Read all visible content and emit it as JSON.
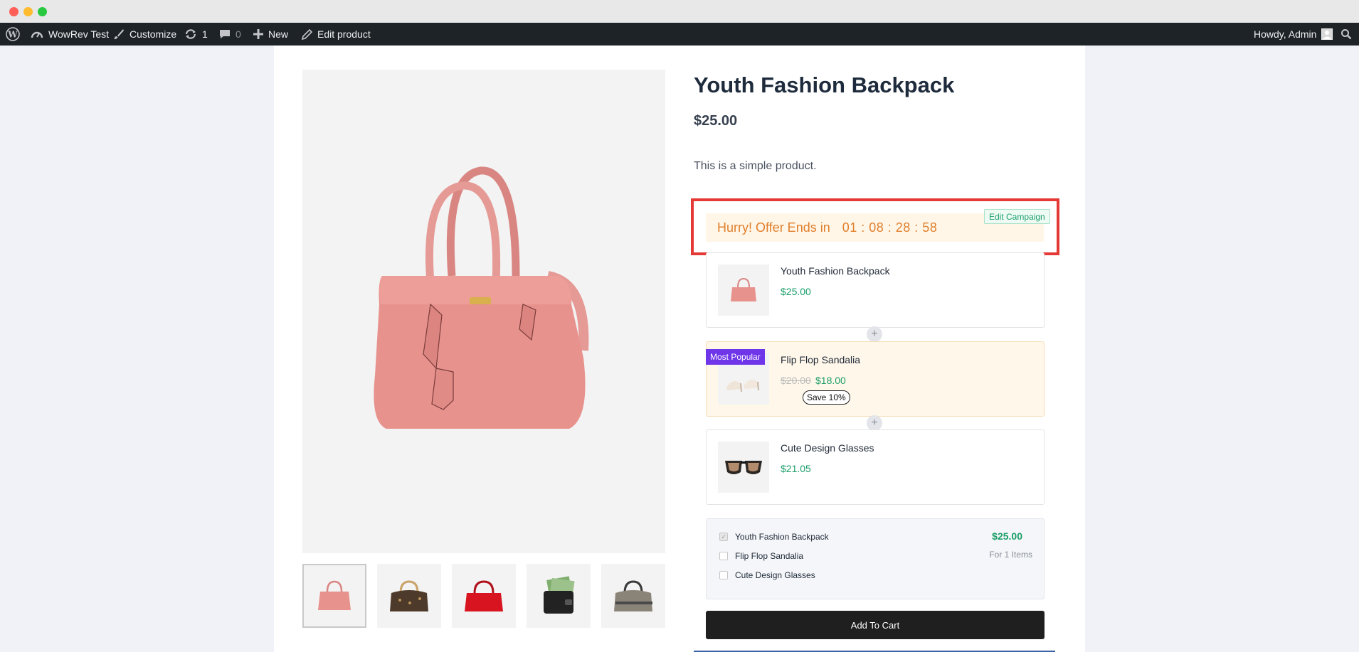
{
  "admin_bar": {
    "site_name": "WowRev Test",
    "customize": "Customize",
    "updates_count": "1",
    "comments_count": "0",
    "new_label": "New",
    "edit_product": "Edit product",
    "howdy": "Howdy, Admin"
  },
  "product": {
    "title": "Youth Fashion Backpack",
    "price": "$25.00",
    "description": "This is a simple product."
  },
  "gallery": {
    "thumbnails": [
      "pink-bag",
      "brown-bag",
      "red-bag",
      "wallet",
      "gray-bag"
    ],
    "active_index": 0
  },
  "campaign": {
    "offer_text": "Hurry! Offer Ends in",
    "countdown": "01 : 08 : 28 : 58",
    "edit_label": "Edit Campaign",
    "items": [
      {
        "name": "Youth Fashion Backpack",
        "price": "$25.00"
      },
      {
        "name": "Flip Flop Sandalia",
        "old_price": "$20.00",
        "price": "$18.00",
        "save": "Save 10%",
        "tag": "Most Popular"
      },
      {
        "name": "Cute Design Glasses",
        "price": "$21.05"
      }
    ],
    "plus": "+",
    "summary": {
      "rows": [
        {
          "label": "Youth Fashion Backpack",
          "checked": true
        },
        {
          "label": "Flip Flop Sandalia",
          "checked": false
        },
        {
          "label": "Cute Design Glasses",
          "checked": false
        }
      ],
      "total": "$25.00",
      "for_items": "For 1 Items"
    },
    "add_to_cart": "Add To Cart"
  },
  "colors": {
    "accent_green": "#1a9e68",
    "offer_orange": "#e07f2b",
    "highlight_red": "#e53935",
    "popular_purple": "#6f35e8"
  }
}
